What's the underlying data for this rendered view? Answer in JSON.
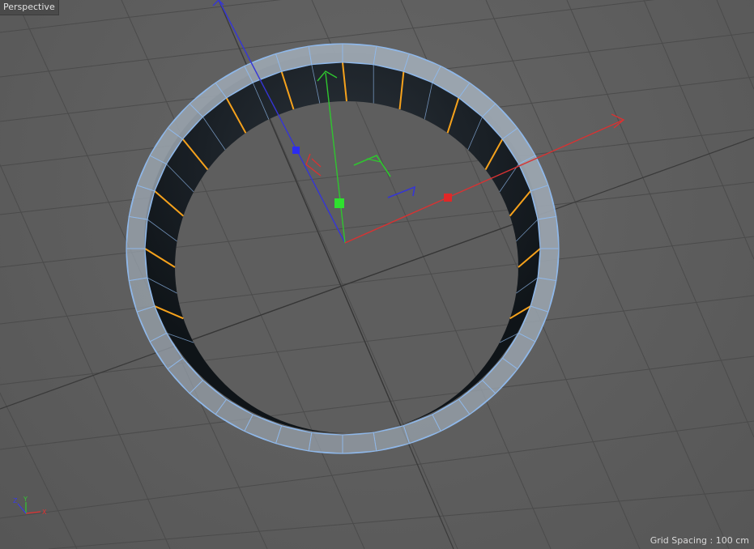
{
  "viewport": {
    "name": "Perspective",
    "grid_spacing_label": "Grid Spacing : 100 cm"
  },
  "axis_colors": {
    "x": "#e03232",
    "y": "#32c832",
    "z": "#3a3ae6"
  },
  "mesh_colors": {
    "wireframe": "#8fb8ea",
    "rim_face": "#9aa4ae",
    "inner_wall": "#141a1f",
    "selected_edges": "#f6a21c"
  },
  "mini_axis_labels": {
    "x": "X",
    "y": "Y",
    "z": "Z"
  }
}
